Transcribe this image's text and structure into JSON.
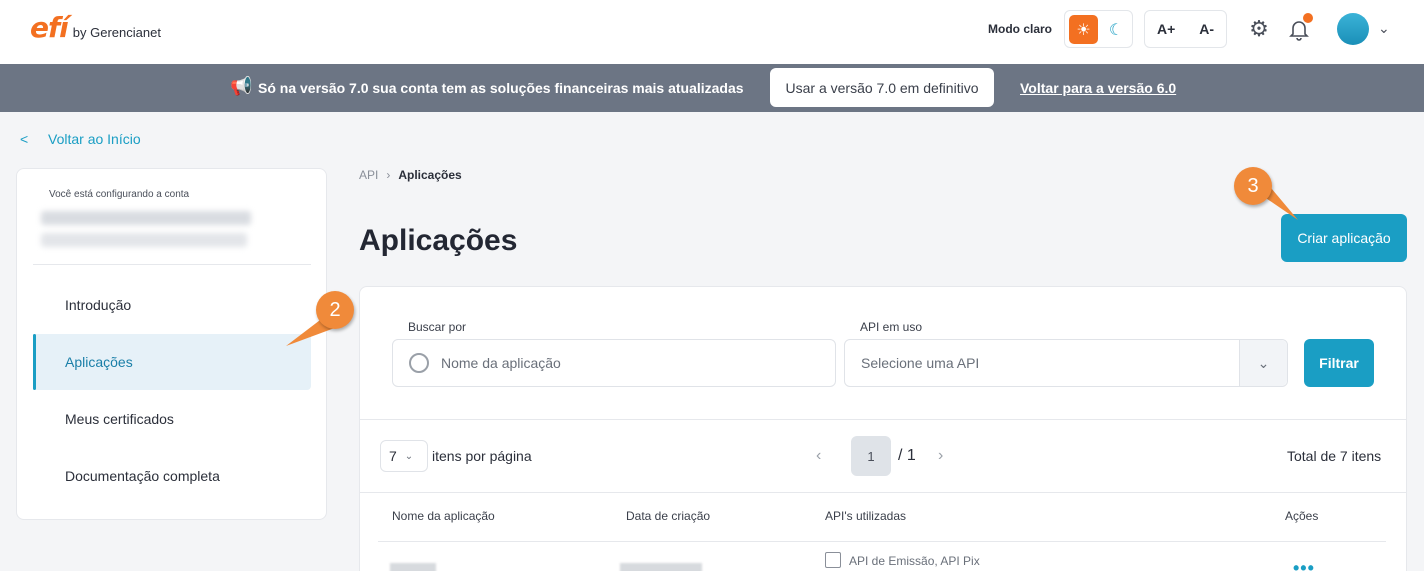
{
  "header": {
    "logo_main": "efí",
    "logo_sub": "by Gerencianet",
    "mode_label": "Modo claro",
    "font_increase": "A+",
    "font_decrease": "A-"
  },
  "banner": {
    "text": "Só na versão 7.0 sua conta tem as soluções financeiras mais atualizadas",
    "button_label": "Usar a versão 7.0 em definitivo",
    "link_label": "Voltar para a versão 6.0"
  },
  "back_link": "Voltar ao Início",
  "sidebar": {
    "caption": "Você está configurando a conta",
    "items": [
      {
        "label": "Introdução",
        "active": false
      },
      {
        "label": "Aplicações",
        "active": true
      },
      {
        "label": "Meus certificados",
        "active": false
      },
      {
        "label": "Documentação completa",
        "active": false
      }
    ]
  },
  "callouts": {
    "sidebar_step": "2",
    "button_step": "3"
  },
  "breadcrumb": {
    "parent": "API",
    "current": "Aplicações"
  },
  "page_title": "Aplicações",
  "create_button": "Criar aplicação",
  "filters": {
    "search_label": "Buscar por",
    "search_placeholder": "Nome da aplicação",
    "api_label": "API em uso",
    "api_placeholder": "Selecione uma API",
    "filter_button": "Filtrar"
  },
  "pagination": {
    "per_page_value": "7",
    "per_page_label": "itens por página",
    "current_page": "1",
    "total_pages": "/ 1",
    "total_label": "Total de 7 itens"
  },
  "table": {
    "columns": [
      "Nome da aplicação",
      "Data de criação",
      "API's utilizadas",
      "Ações"
    ],
    "rows": [
      {
        "apis": "API de Emissão, API Pix",
        "actions": "•••"
      }
    ]
  },
  "colors": {
    "accent": "#1a9ec4",
    "brand": "#f37021",
    "banner": "#6c7584"
  }
}
